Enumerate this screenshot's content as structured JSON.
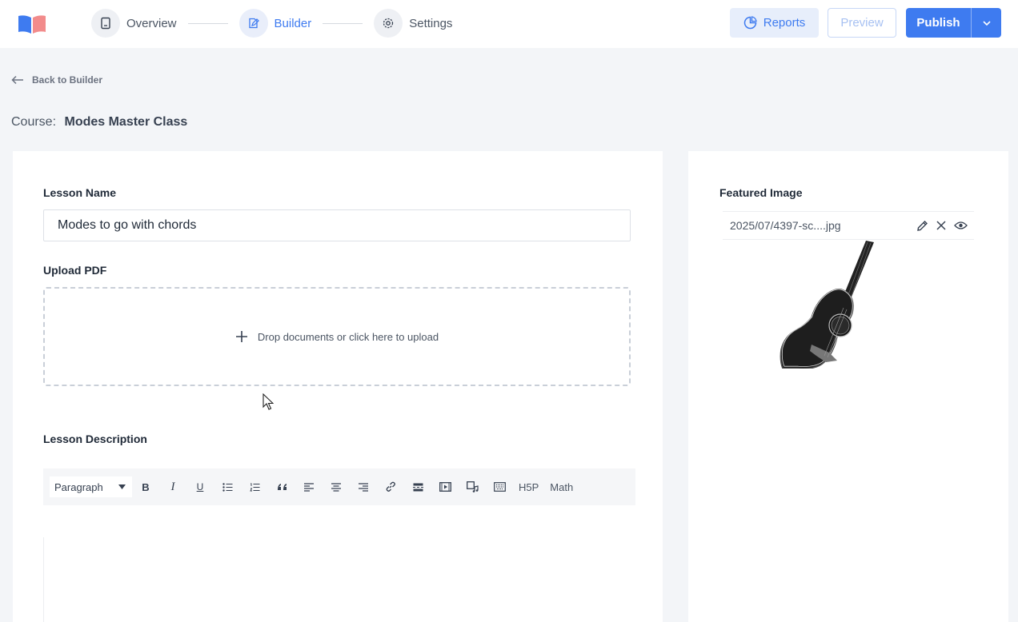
{
  "header": {
    "steps": [
      {
        "label": "Overview",
        "icon": "book-icon"
      },
      {
        "label": "Builder",
        "icon": "edit-icon"
      },
      {
        "label": "Settings",
        "icon": "gear-icon"
      }
    ],
    "reports_label": "Reports",
    "preview_label": "Preview",
    "publish_label": "Publish"
  },
  "nav": {
    "back_label": "Back to Builder",
    "course_prefix": "Course:",
    "course_name": "Modes Master Class"
  },
  "form": {
    "lesson_name_label": "Lesson Name",
    "lesson_name_value": "Modes to go with chords",
    "upload_pdf_label": "Upload PDF",
    "dropzone_text": "Drop documents or click here to upload",
    "description_label": "Lesson Description",
    "editor": {
      "format_value": "Paragraph",
      "text_buttons": [
        "H5P",
        "Math"
      ]
    }
  },
  "sidebar": {
    "featured_image_label": "Featured Image",
    "file_name": "2025/07/4397-sc....jpg"
  },
  "colors": {
    "accent": "#3e7bf0",
    "accent_light": "#e7eefb",
    "background": "#f3f5f8"
  }
}
